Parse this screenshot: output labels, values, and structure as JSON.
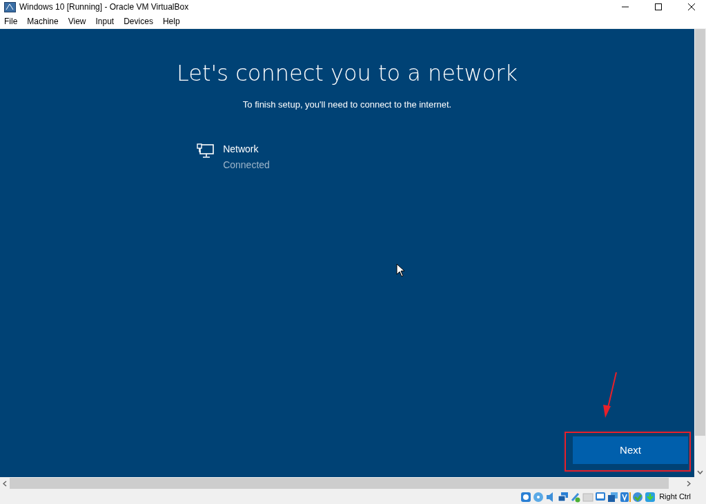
{
  "window": {
    "title": "Windows 10 [Running] - Oracle VM VirtualBox"
  },
  "menu": [
    "File",
    "Machine",
    "View",
    "Input",
    "Devices",
    "Help"
  ],
  "setup": {
    "heading": "Let's connect you to a network",
    "subheading": "To finish setup, you'll need to connect to the internet.",
    "network": {
      "name": "Network",
      "status": "Connected"
    },
    "next_button": "Next"
  },
  "status_bar": {
    "host_key": "Right Ctrl"
  }
}
